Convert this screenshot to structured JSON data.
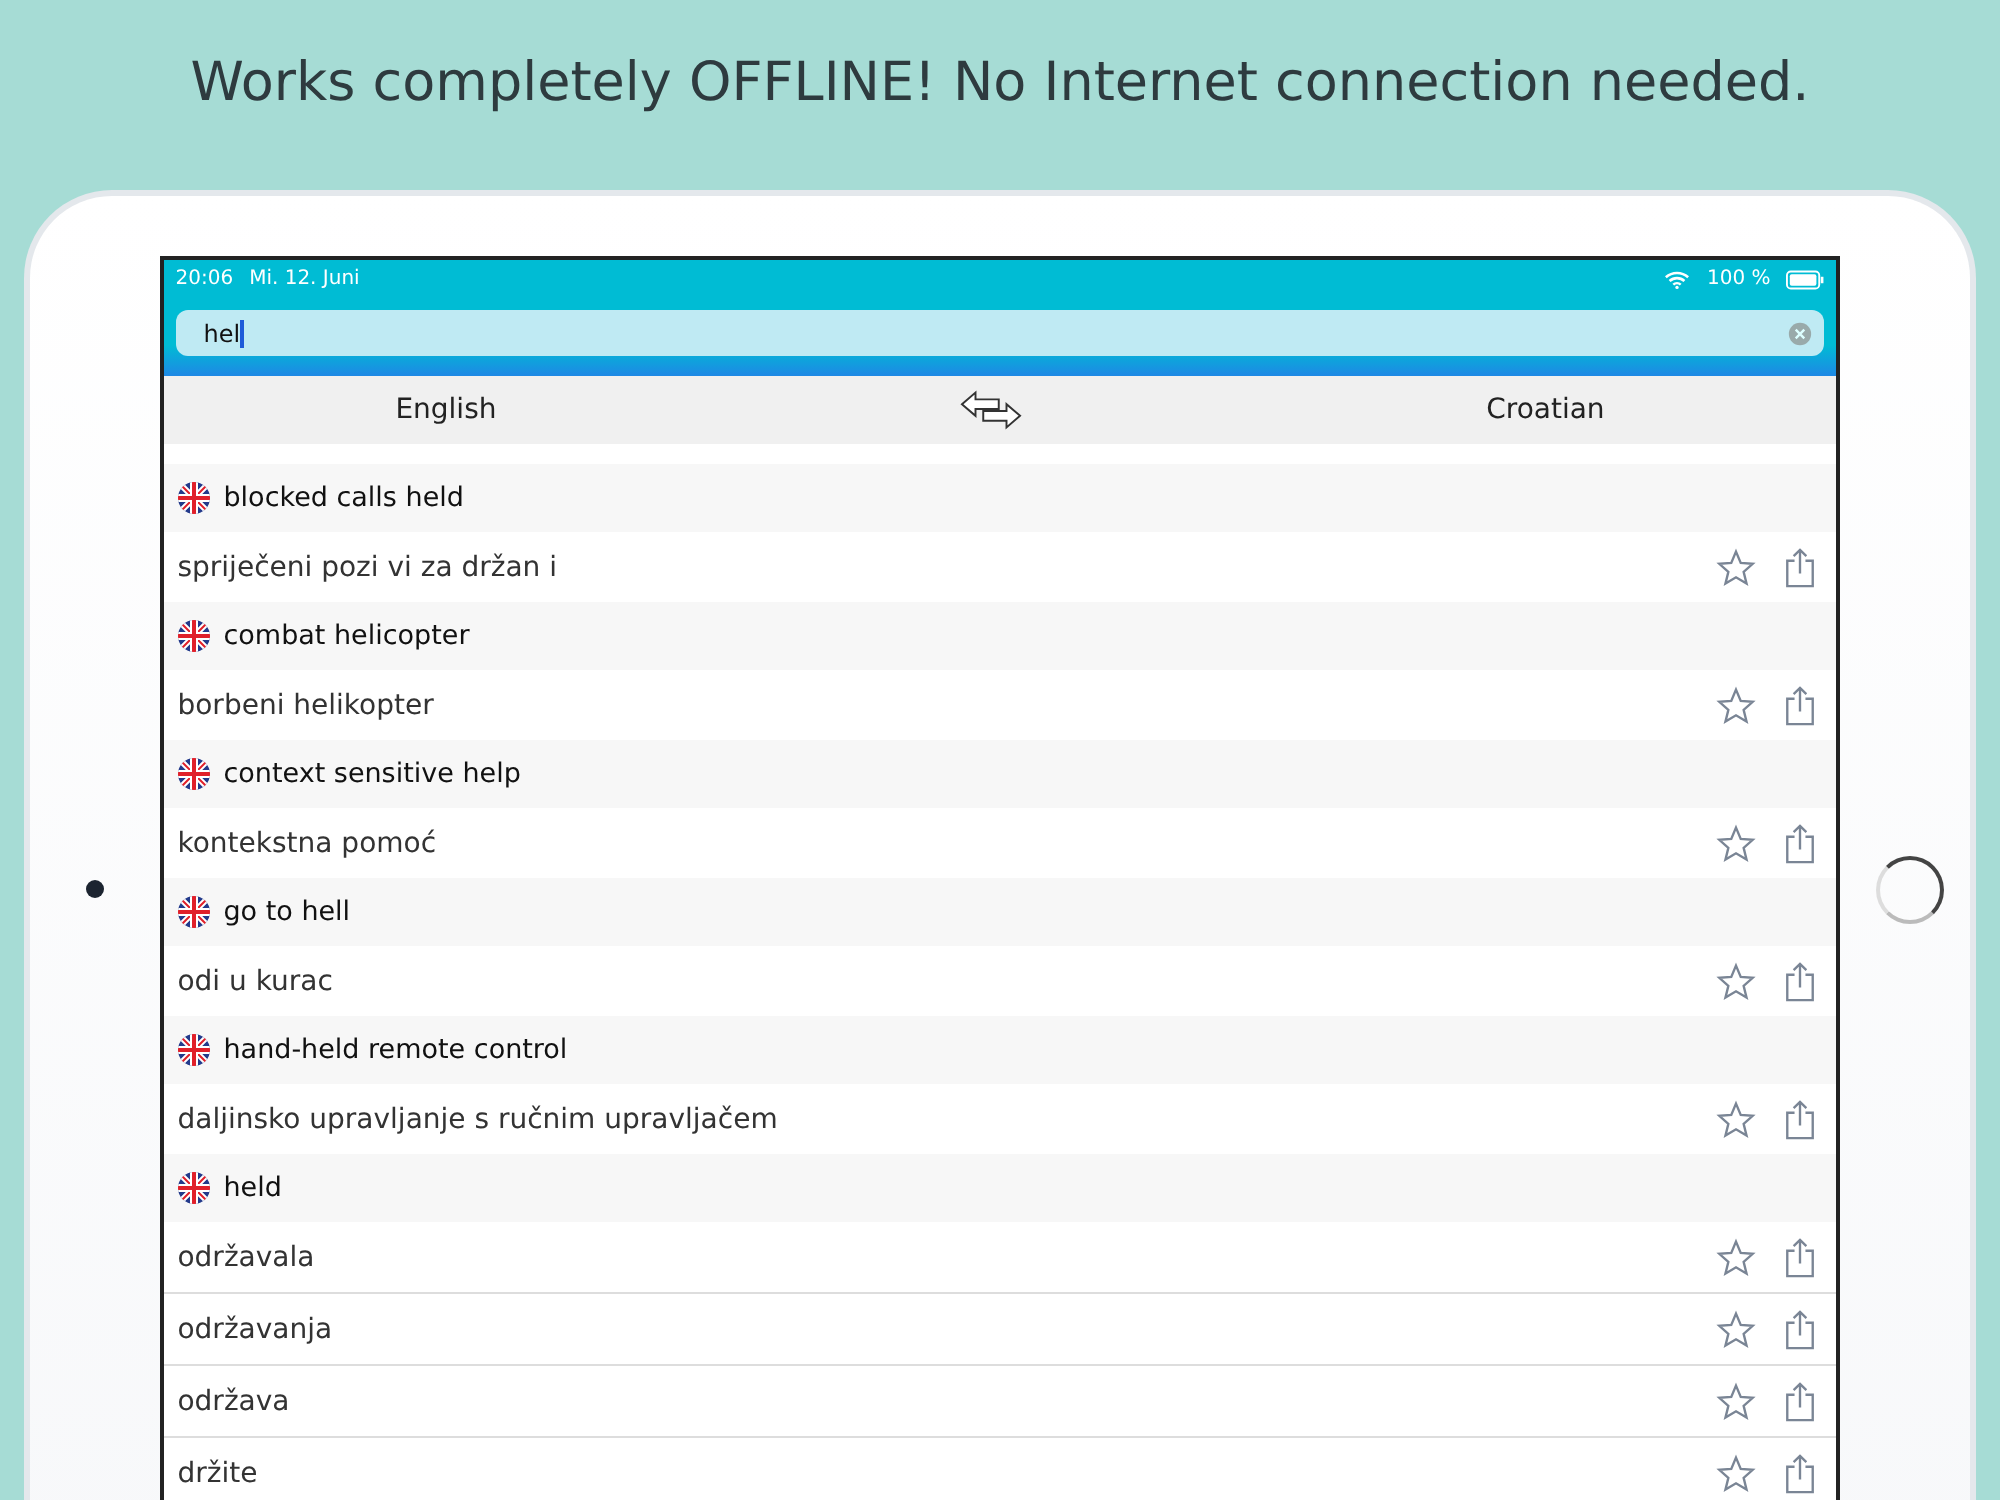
{
  "headline": "Works completely OFFLINE! No Internet connection needed.",
  "status_bar": {
    "time": "20:06",
    "date": "Mi. 12. Juni",
    "battery": "100 %"
  },
  "search": {
    "value": "hel"
  },
  "languages": {
    "source": "English",
    "target": "Croatian"
  },
  "entries": [
    {
      "term": "blocked calls held",
      "translations": [
        "spriječeni pozi vi za držan i"
      ]
    },
    {
      "term": "combat helicopter",
      "translations": [
        "borbeni helikopter"
      ]
    },
    {
      "term": "context sensitive help",
      "translations": [
        "kontekstna pomoć"
      ]
    },
    {
      "term": "go to hell",
      "translations": [
        "odi u kurac"
      ]
    },
    {
      "term": "hand-held remote control",
      "translations": [
        "daljinsko upravljanje s ručnim upravljačem"
      ]
    },
    {
      "term": "held",
      "translations": [
        "održavala",
        "održavanja",
        "održava",
        "držite"
      ]
    }
  ]
}
